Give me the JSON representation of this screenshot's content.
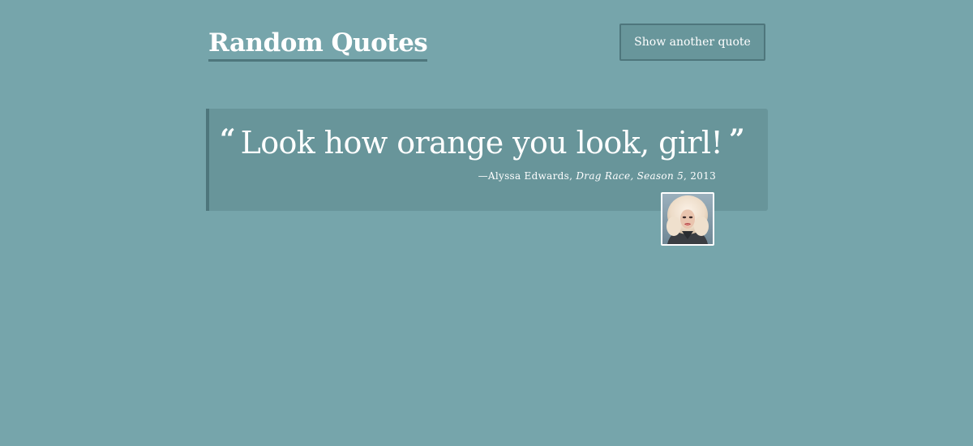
{
  "header": {
    "title": "Random Quotes",
    "button_label": "Show another quote"
  },
  "quote": {
    "open_mark": "“",
    "close_mark": "”",
    "text": "Look how orange you look, girl!",
    "author_prefix": "—Alyssa Edwards,",
    "show": "Drag Race, Season 5",
    "year": ", 2013"
  },
  "avatar": {
    "alt": "Alyssa Edwards portrait"
  },
  "colors": {
    "background": "#76a5ab",
    "panel": "#68959a",
    "accent_border": "#4e767c",
    "text": "#ffffff"
  }
}
